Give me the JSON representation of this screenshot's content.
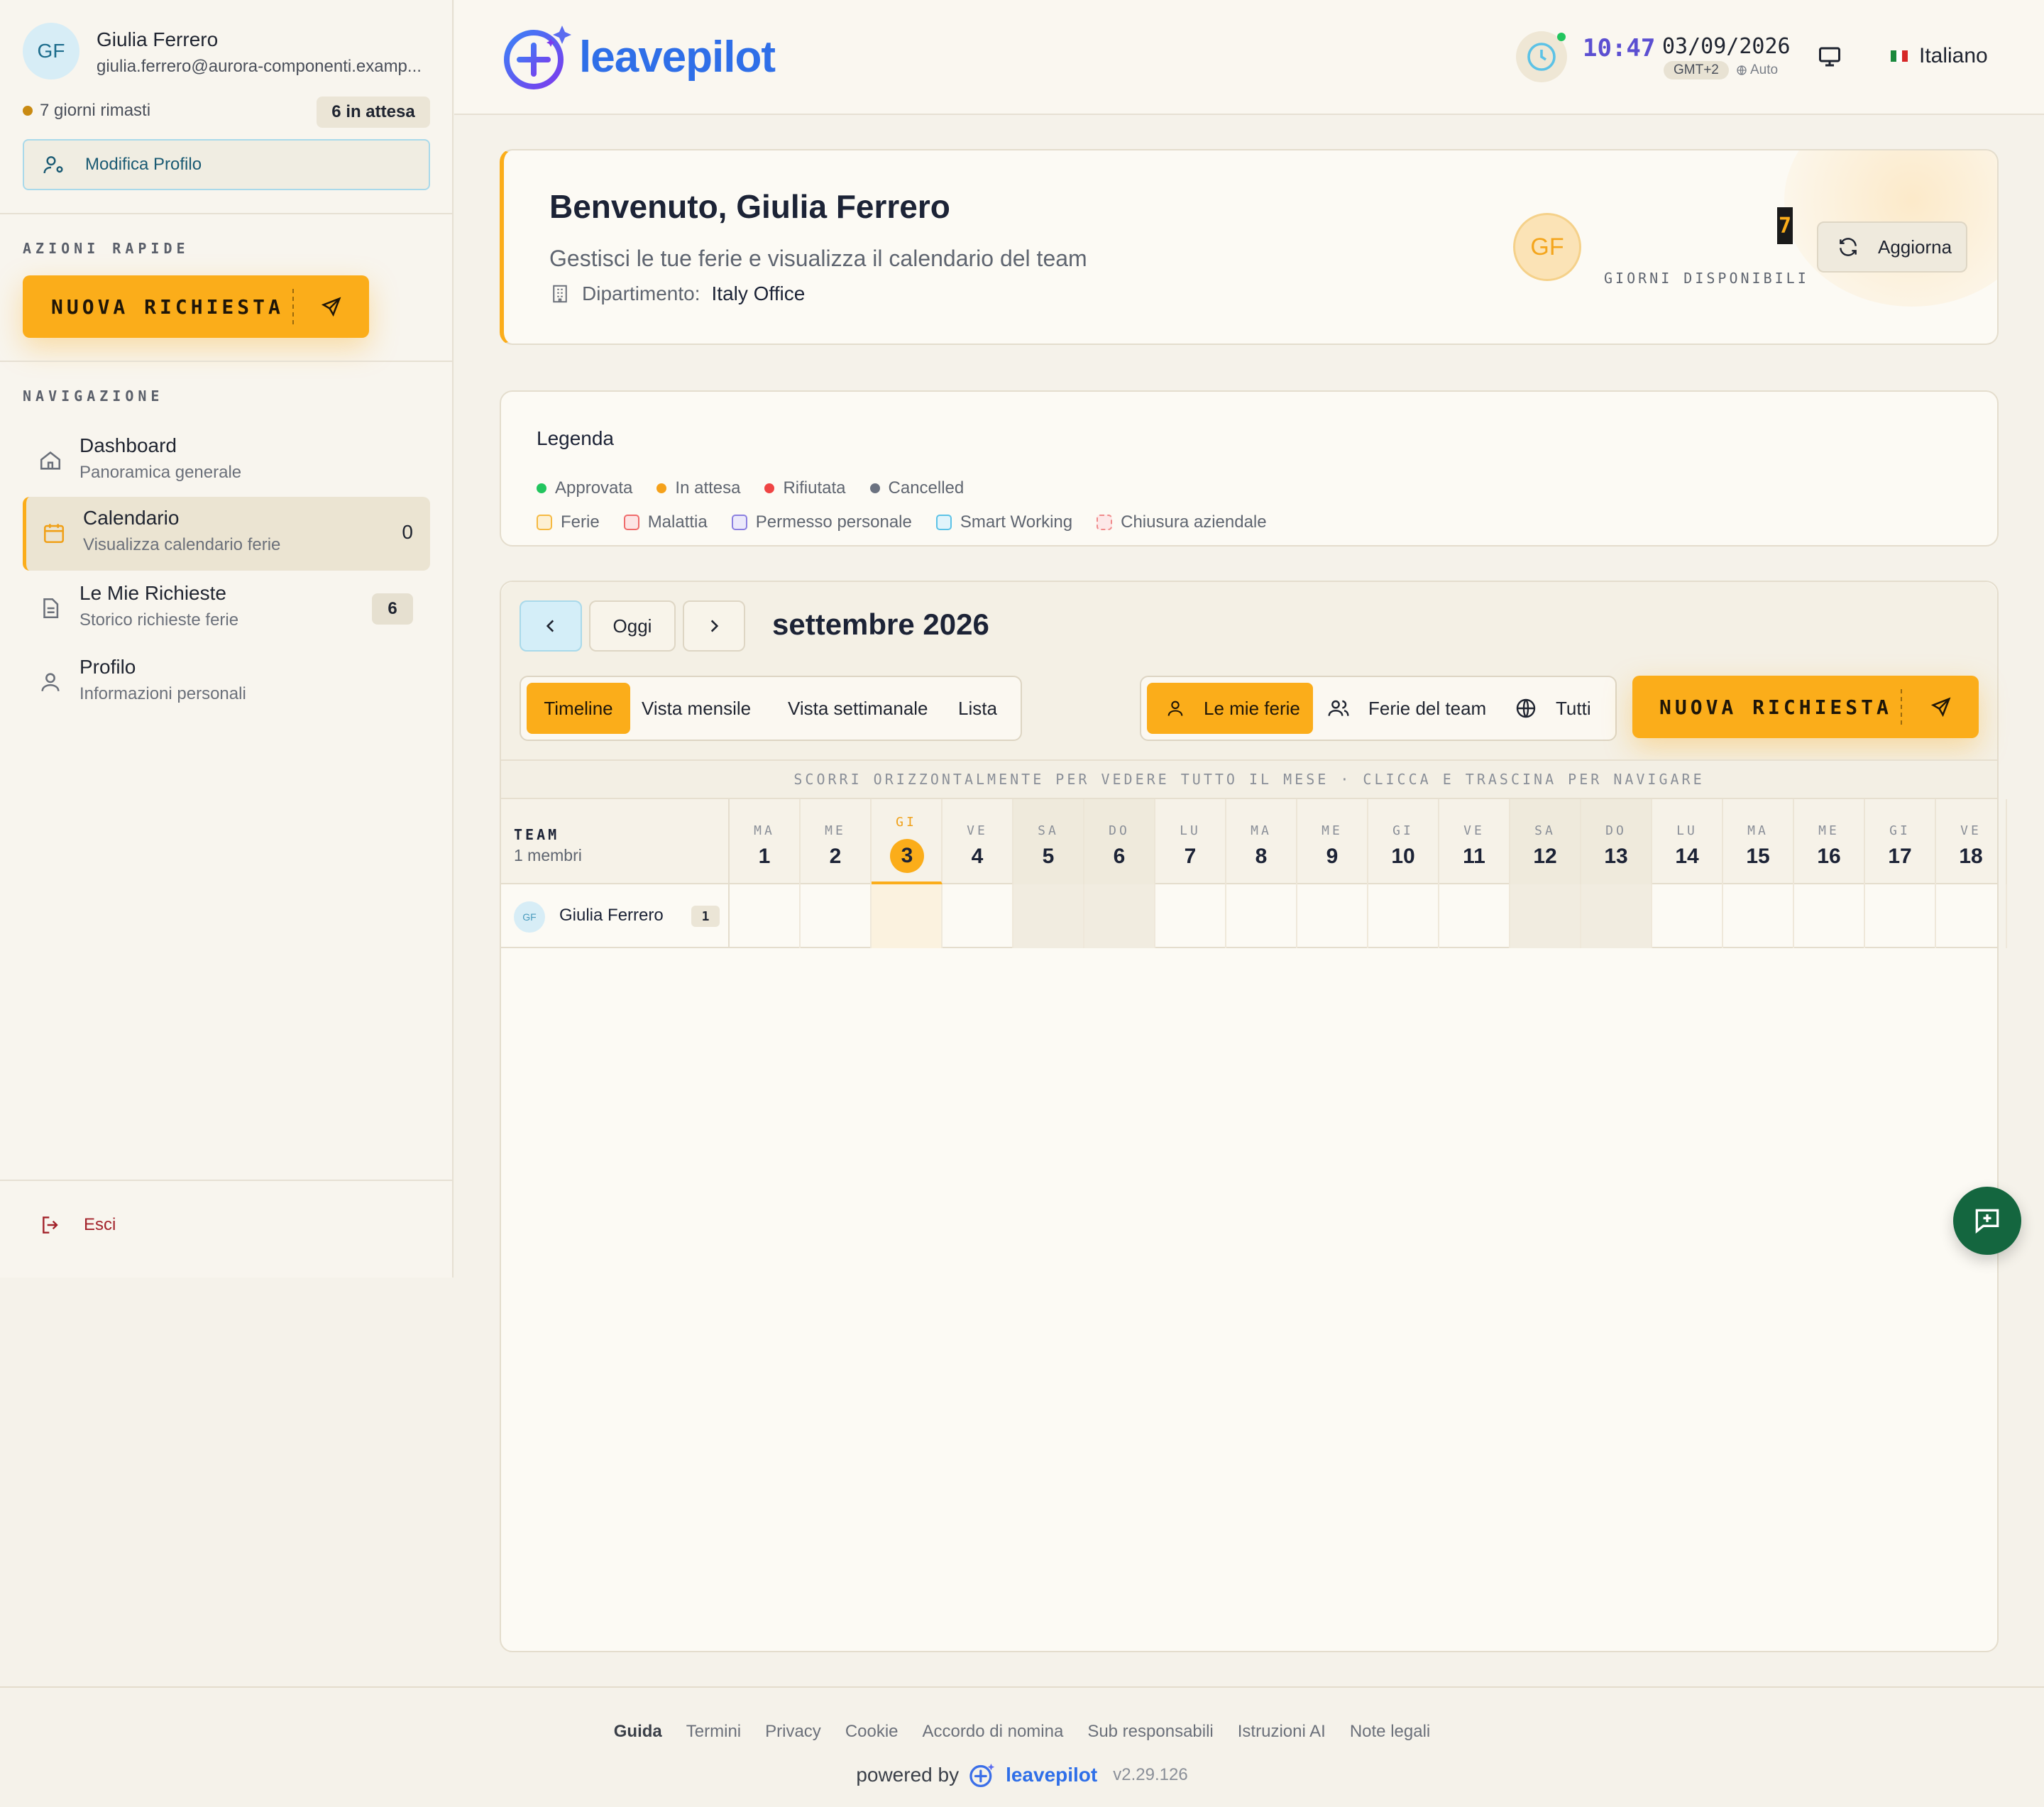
{
  "user": {
    "initials": "GF",
    "name": "Giulia Ferrero",
    "email": "giulia.ferrero@aurora-componenti.examp...",
    "days_left": "7 giorni rimasti",
    "pending": "6 in attesa",
    "edit_profile": "Modifica Profilo"
  },
  "sidebar": {
    "quick_actions_title": "AZIONI RAPIDE",
    "new_request": "NUOVA RICHIESTA",
    "navigation_title": "NAVIGAZIONE",
    "items": [
      {
        "title": "Dashboard",
        "subtitle": "Panoramica generale"
      },
      {
        "title": "Calendario",
        "subtitle": "Visualizza calendario ferie",
        "count": "0"
      },
      {
        "title": "Le Mie Richieste",
        "subtitle": "Storico richieste ferie",
        "badge": "6"
      },
      {
        "title": "Profilo",
        "subtitle": "Informazioni personali"
      }
    ],
    "exit": "Esci"
  },
  "header": {
    "logo": "leavepilot",
    "time": "10:47",
    "date": "03/09/2026",
    "timezone": "GMT+2",
    "tz_mode": "Auto",
    "language": "Italiano"
  },
  "welcome": {
    "title": "Benvenuto, Giulia Ferrero",
    "subtitle": "Gestisci le tue ferie e visualizza il calendario del team",
    "dept_label": "Dipartimento:",
    "dept_value": "Italy Office",
    "avatar": "GF",
    "days_available": "7",
    "days_available_label": "GIORNI DISPONIBILI",
    "refresh": "Aggiorna"
  },
  "legend": {
    "title": "Legenda",
    "statuses": [
      {
        "label": "Approvata",
        "color": "#22c55e"
      },
      {
        "label": "In attesa",
        "color": "#f5a11a"
      },
      {
        "label": "Rifiutata",
        "color": "#ef4444"
      },
      {
        "label": "Cancelled",
        "color": "#6b7280"
      }
    ],
    "types": [
      {
        "label": "Ferie",
        "color": "#f5b942"
      },
      {
        "label": "Malattia",
        "color": "#ef6b6b"
      },
      {
        "label": "Permesso personale",
        "color": "#8b7fe0"
      },
      {
        "label": "Smart Working",
        "color": "#5cc2e6"
      },
      {
        "label": "Chiusura aziendale",
        "color": "#f08a8a"
      }
    ]
  },
  "calendar": {
    "today_button": "Oggi",
    "month": "settembre 2026",
    "views": [
      "Timeline",
      "Vista mensile",
      "Vista settimanale",
      "Lista"
    ],
    "filters": [
      "Le mie ferie",
      "Ferie del team",
      "Tutti"
    ],
    "new_request": "NUOVA RICHIESTA",
    "scroll_hint": "SCORRI ORIZZONTALMENTE PER VEDERE TUTTO IL MESE · CLICCA E TRASCINA PER NAVIGARE",
    "team_label": "TEAM",
    "team_members": "1 membri",
    "days": [
      {
        "dow": "MA",
        "num": "1"
      },
      {
        "dow": "ME",
        "num": "2"
      },
      {
        "dow": "GI",
        "num": "3"
      },
      {
        "dow": "VE",
        "num": "4"
      },
      {
        "dow": "SA",
        "num": "5"
      },
      {
        "dow": "DO",
        "num": "6"
      },
      {
        "dow": "LU",
        "num": "7"
      },
      {
        "dow": "MA",
        "num": "8"
      },
      {
        "dow": "ME",
        "num": "9"
      },
      {
        "dow": "GI",
        "num": "10"
      },
      {
        "dow": "VE",
        "num": "11"
      },
      {
        "dow": "SA",
        "num": "12"
      },
      {
        "dow": "DO",
        "num": "13"
      },
      {
        "dow": "LU",
        "num": "14"
      },
      {
        "dow": "MA",
        "num": "15"
      },
      {
        "dow": "ME",
        "num": "16"
      },
      {
        "dow": "GI",
        "num": "17"
      },
      {
        "dow": "VE",
        "num": "18"
      }
    ],
    "rows": [
      {
        "initials": "GF",
        "name": "Giulia Ferrero",
        "count": "1"
      }
    ]
  },
  "footer": {
    "links": [
      "Guida",
      "Termini",
      "Privacy",
      "Cookie",
      "Accordo di nomina",
      "Sub responsabili",
      "Istruzioni AI",
      "Note legali"
    ],
    "powered_by": "powered by",
    "logo": "leavepilot",
    "version": "v2.29.126"
  }
}
